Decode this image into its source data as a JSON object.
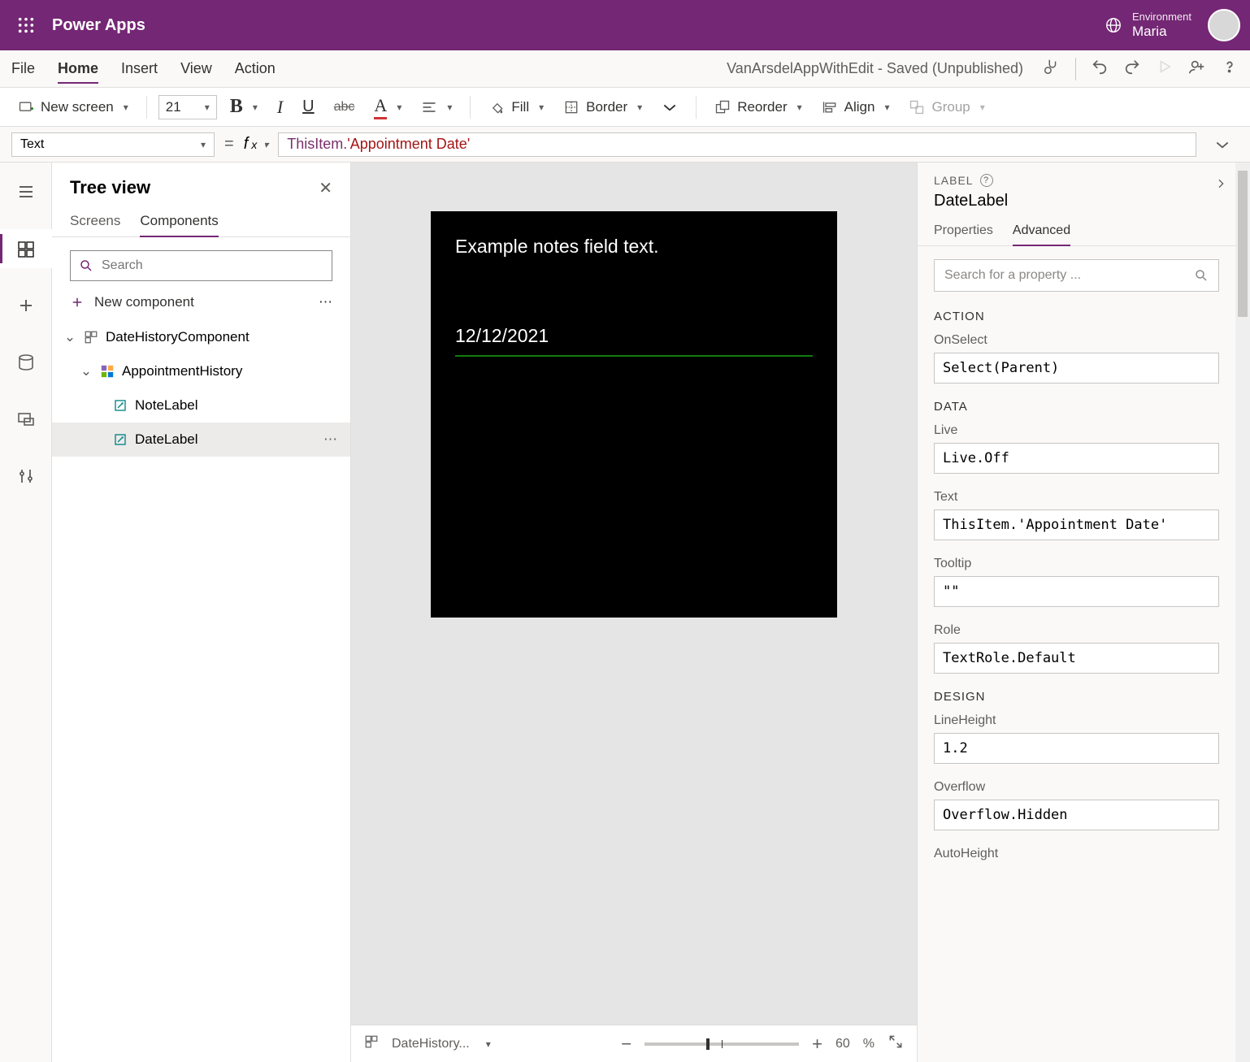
{
  "header": {
    "app_title": "Power Apps",
    "env_label": "Environment",
    "env_name": "Maria"
  },
  "menu": {
    "items": [
      "File",
      "Home",
      "Insert",
      "View",
      "Action"
    ],
    "active": "Home",
    "doc_title": "VanArsdelAppWithEdit - Saved (Unpublished)"
  },
  "ribbon": {
    "new_screen": "New screen",
    "font_size": "21",
    "fill": "Fill",
    "border": "Border",
    "reorder": "Reorder",
    "align": "Align",
    "group": "Group"
  },
  "formula": {
    "property": "Text",
    "expression_prefix": "ThisItem.",
    "expression_string": "'Appointment Date'"
  },
  "tree": {
    "title": "Tree view",
    "tabs": [
      "Screens",
      "Components"
    ],
    "active_tab": "Components",
    "search_placeholder": "Search",
    "new_component": "New component",
    "items": {
      "root": "DateHistoryComponent",
      "child": "AppointmentHistory",
      "leaf1": "NoteLabel",
      "leaf2": "DateLabel"
    }
  },
  "canvas": {
    "note_text": "Example notes field text.",
    "date_text": "12/12/2021"
  },
  "footer": {
    "breadcrumb": "DateHistory...",
    "zoom_value": "60",
    "zoom_unit": "%"
  },
  "props": {
    "control_type": "LABEL",
    "control_name": "DateLabel",
    "tabs": [
      "Properties",
      "Advanced"
    ],
    "active_tab": "Advanced",
    "search_placeholder": "Search for a property ...",
    "sections": {
      "action": "ACTION",
      "data": "DATA",
      "design": "DESIGN"
    },
    "fields": {
      "OnSelect": {
        "label": "OnSelect",
        "value": "Select(Parent)"
      },
      "Live": {
        "label": "Live",
        "value": "Live.Off"
      },
      "Text": {
        "label": "Text",
        "value": "ThisItem.'Appointment Date'"
      },
      "Tooltip": {
        "label": "Tooltip",
        "value": "\"\""
      },
      "Role": {
        "label": "Role",
        "value": "TextRole.Default"
      },
      "LineHeight": {
        "label": "LineHeight",
        "value": "1.2"
      },
      "Overflow": {
        "label": "Overflow",
        "value": "Overflow.Hidden"
      },
      "AutoHeight": {
        "label": "AutoHeight",
        "value": ""
      }
    }
  }
}
